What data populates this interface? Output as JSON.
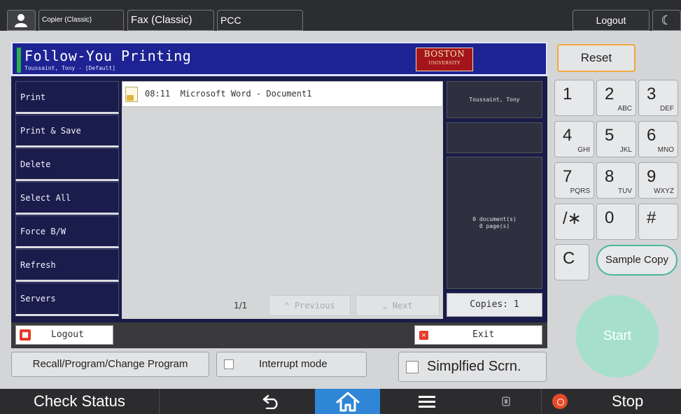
{
  "topbar": {
    "copier_classic": "Copier (Classic)",
    "fax_classic": "Fax (Classic)",
    "pcc": "PCC",
    "logout": "Logout",
    "moon_glyph": "☾"
  },
  "app": {
    "title": "Follow-You Printing",
    "user": "Toussaint, Tony - [Default]",
    "logo_line1": "BOSTON",
    "logo_line2": "UNIVERSITY",
    "menu": [
      "Print",
      "Print & Save",
      "Delete",
      "Select All",
      "Force B/W",
      "Refresh",
      "Servers"
    ],
    "job": {
      "time": "08:11",
      "name": "Microsoft Word - Document1"
    },
    "page_count": "1/1",
    "prev_label": "⌃ Previous",
    "next_label": "⌄ Next",
    "info_name": "Toussaint, Tony",
    "info_docs": "0 document(s)",
    "info_pages": "0 page(s)",
    "copies_label": "Copies: 1",
    "logout_label": "Logout",
    "exit_label": "Exit",
    "exit_glyph": "✕"
  },
  "controls": {
    "recall": "Recall/Program/Change Program",
    "interrupt": "Interrupt mode",
    "simplified": "Simplfied Scrn."
  },
  "keypad": {
    "reset": "Reset",
    "keys": [
      {
        "digit": "1",
        "sub": ""
      },
      {
        "digit": "2",
        "sub": "ABC"
      },
      {
        "digit": "3",
        "sub": "DEF"
      },
      {
        "digit": "4",
        "sub": "GHI"
      },
      {
        "digit": "5",
        "sub": "JKL"
      },
      {
        "digit": "6",
        "sub": "MNO"
      },
      {
        "digit": "7",
        "sub": "PQRS"
      },
      {
        "digit": "8",
        "sub": "TUV"
      },
      {
        "digit": "9",
        "sub": "WXYZ"
      },
      {
        "digit": "/∗",
        "sub": ""
      },
      {
        "digit": "0",
        "sub": ""
      },
      {
        "digit": "#",
        "sub": ""
      },
      {
        "digit": "C",
        "sub": ""
      }
    ],
    "sample_copy": "Sample Copy",
    "start": "Start"
  },
  "bottombar": {
    "check_status": "Check Status",
    "stop": "Stop"
  },
  "colors": {
    "app_header": "#1e2393",
    "menu_bg": "#1a1c4c",
    "accent_reset": "#f0a93a",
    "start": "#a6e0cd",
    "home_tab": "#2f86d6",
    "stop": "#e54a2a"
  }
}
